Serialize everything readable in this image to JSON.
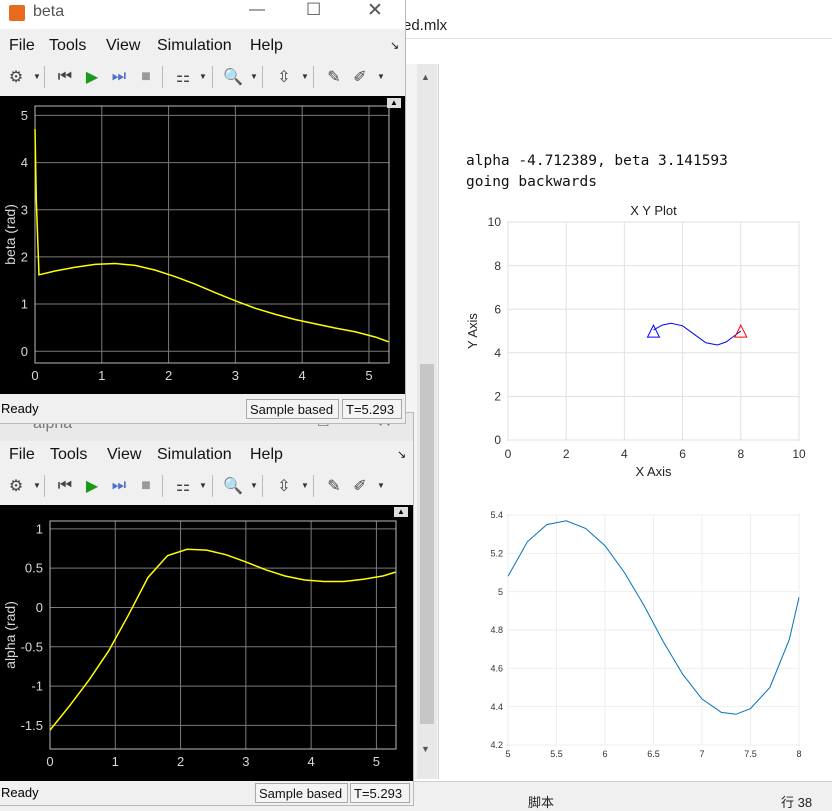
{
  "editor": {
    "file_name_fragment": "ed.mlx",
    "output_line1": "alpha -4.712389, beta 3.141593",
    "output_line2": "going backwards",
    "status_left": "脚本",
    "status_right": "行  38"
  },
  "beta_window": {
    "title": "beta",
    "menu": [
      "File",
      "Tools",
      "View",
      "Simulation",
      "Help"
    ],
    "status_ready": "Ready",
    "status_mode": "Sample based",
    "status_time": "T=5.293"
  },
  "alpha_window": {
    "title": "alpha",
    "menu": [
      "File",
      "Tools",
      "View",
      "Simulation",
      "Help"
    ],
    "status_ready": "Ready",
    "status_mode": "Sample based",
    "status_time": "T=5.293"
  },
  "colors": {
    "trace": "#ffff00",
    "grid": "#7a7a7a",
    "blue_path": "#0000ff",
    "red_marker": "#ff0000",
    "curve": "#0072bd"
  },
  "chart_data": [
    {
      "id": "beta_scope",
      "type": "line",
      "ylabel": "beta (rad)",
      "xlim": [
        0,
        5.3
      ],
      "ylim": [
        -0.25,
        5.2
      ],
      "xticks": [
        0,
        1,
        2,
        3,
        4,
        5
      ],
      "yticks": [
        0,
        1,
        2,
        3,
        4,
        5
      ],
      "series": [
        {
          "x": [
            0,
            0.02,
            0.06,
            0.3,
            0.6,
            0.9,
            1.2,
            1.5,
            1.8,
            2.1,
            2.4,
            2.7,
            3.0,
            3.3,
            3.6,
            3.9,
            4.2,
            4.5,
            4.8,
            5.1,
            5.293
          ],
          "y": [
            4.71,
            3.2,
            1.62,
            1.7,
            1.78,
            1.84,
            1.86,
            1.82,
            1.72,
            1.58,
            1.42,
            1.24,
            1.07,
            0.91,
            0.78,
            0.67,
            0.58,
            0.49,
            0.41,
            0.3,
            0.2
          ]
        }
      ]
    },
    {
      "id": "alpha_scope",
      "type": "line",
      "ylabel": "alpha (rad)",
      "xlim": [
        0,
        5.3
      ],
      "ylim": [
        -1.8,
        1.1
      ],
      "xticks": [
        0,
        1,
        2,
        3,
        4,
        5
      ],
      "yticks": [
        -1.5,
        -1,
        -0.5,
        0,
        0.5,
        1
      ],
      "series": [
        {
          "x": [
            0,
            0.3,
            0.6,
            0.9,
            1.2,
            1.5,
            1.8,
            2.1,
            2.4,
            2.7,
            3.0,
            3.3,
            3.6,
            3.9,
            4.2,
            4.5,
            4.8,
            5.1,
            5.293
          ],
          "y": [
            -1.56,
            -1.25,
            -0.92,
            -0.55,
            -0.1,
            0.38,
            0.66,
            0.74,
            0.73,
            0.67,
            0.58,
            0.48,
            0.4,
            0.35,
            0.33,
            0.33,
            0.36,
            0.4,
            0.45
          ]
        }
      ]
    },
    {
      "id": "xy_plot",
      "type": "line",
      "title": "X Y Plot",
      "xlabel": "X Axis",
      "ylabel": "Y Axis",
      "xlim": [
        0,
        10
      ],
      "ylim": [
        0,
        10
      ],
      "xticks": [
        0,
        2,
        4,
        6,
        8,
        10
      ],
      "yticks": [
        0,
        2,
        4,
        6,
        8,
        10
      ],
      "series": [
        {
          "x": [
            5.0,
            5.3,
            5.6,
            6.0,
            6.4,
            6.8,
            7.2,
            7.5,
            7.8,
            8.0
          ],
          "y": [
            5.05,
            5.27,
            5.36,
            5.24,
            4.85,
            4.46,
            4.36,
            4.5,
            4.8,
            5.0
          ]
        }
      ],
      "markers": [
        {
          "x": 5.0,
          "y": 4.9,
          "color": "blue"
        },
        {
          "x": 8.0,
          "y": 4.9,
          "color": "red"
        }
      ]
    },
    {
      "id": "zoom_plot",
      "type": "line",
      "xlim": [
        5,
        8
      ],
      "ylim": [
        4.2,
        5.4
      ],
      "xticks": [
        5,
        5.5,
        6,
        6.5,
        7,
        7.5,
        8
      ],
      "yticks": [
        4.2,
        4.4,
        4.6,
        4.8,
        5,
        5.2,
        5.4
      ],
      "series": [
        {
          "x": [
            5.0,
            5.2,
            5.4,
            5.6,
            5.8,
            6.0,
            6.2,
            6.4,
            6.6,
            6.8,
            7.0,
            7.2,
            7.35,
            7.5,
            7.7,
            7.9,
            8.0
          ],
          "y": [
            5.08,
            5.26,
            5.35,
            5.37,
            5.33,
            5.24,
            5.1,
            4.93,
            4.74,
            4.57,
            4.44,
            4.37,
            4.36,
            4.39,
            4.5,
            4.75,
            4.97
          ]
        }
      ]
    }
  ]
}
